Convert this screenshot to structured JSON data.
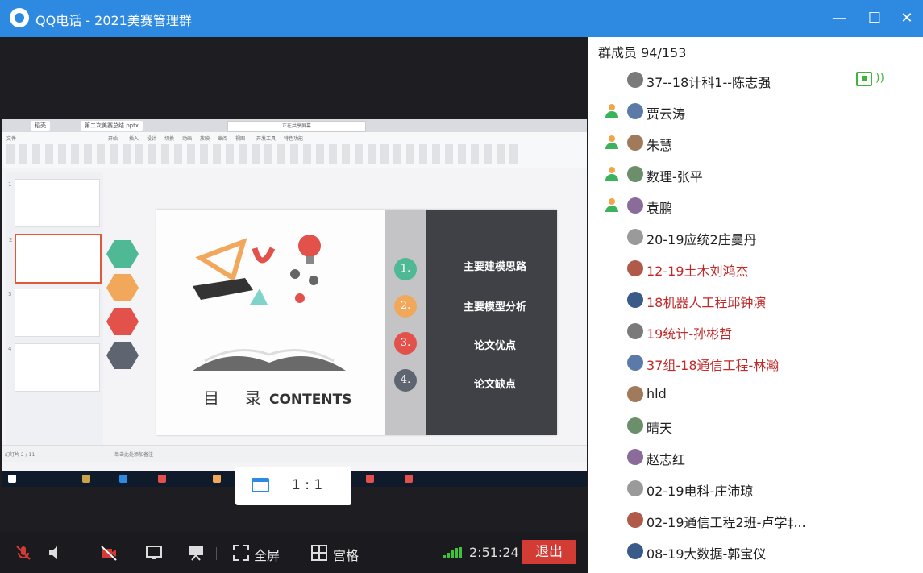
{
  "window": {
    "title": "QQ电话 - 2021美赛管理群",
    "min_label": "—",
    "max_label": "☐",
    "close_label": "✕"
  },
  "shared_screen": {
    "wps_tabs": [
      "稻壳",
      "第二次美赛总结.pptx"
    ],
    "record_bar": "正在共享屏幕",
    "menu": [
      "文件",
      "开始",
      "插入",
      "设计",
      "切换",
      "动画",
      "放映",
      "审阅",
      "视图",
      "开发工具",
      "特色功能"
    ],
    "slide": {
      "mulu_1": "目",
      "mulu_2": "录",
      "contents": "CONTENTS",
      "numbers": [
        "1.",
        "2.",
        "3.",
        "4."
      ],
      "items": [
        "主要建模思路",
        "主要模型分析",
        "论文优点",
        "论文缺点"
      ]
    },
    "thumb_numbers": [
      "1",
      "2",
      "3",
      "4"
    ],
    "status_left": "幻灯片 2 / 11",
    "status_note": "单击此处添加备注"
  },
  "ratio_button": {
    "label": "1 : 1"
  },
  "controls": {
    "fullscreen_label": "全屏",
    "grid_label": "宫格",
    "timer": "2:51:24",
    "exit_label": "退出"
  },
  "members": {
    "header": "群成员 94/153",
    "list": [
      {
        "name": "37--18计科1--陈志强",
        "red": false,
        "host": false,
        "sharing": true
      },
      {
        "name": "贾云涛",
        "red": false,
        "host": true
      },
      {
        "name": "朱慧",
        "red": false,
        "host": true
      },
      {
        "name": "数理-张平",
        "red": false,
        "host": true
      },
      {
        "name": "袁鹏",
        "red": false,
        "host": true
      },
      {
        "name": "20-19应统2庄曼丹",
        "red": false,
        "host": false
      },
      {
        "name": "12-19土木刘鸿杰",
        "red": true,
        "host": false
      },
      {
        "name": "18机器人工程邱钟演",
        "red": true,
        "host": false
      },
      {
        "name": "19统计-孙彬哲",
        "red": true,
        "host": false
      },
      {
        "name": "37组-18通信工程-林瀚",
        "red": true,
        "host": false
      },
      {
        "name": "hld",
        "red": false,
        "host": false
      },
      {
        "name": "晴天",
        "red": false,
        "host": false
      },
      {
        "name": "赵志红",
        "red": false,
        "host": false
      },
      {
        "name": "02-19电科-庄沛琼",
        "red": false,
        "host": false
      },
      {
        "name": "02-19通信工程2班-卢学‡...",
        "red": false,
        "host": false
      },
      {
        "name": "08-19大数据-郭宝仪",
        "red": false,
        "host": false
      }
    ]
  },
  "colors": {
    "titlebar": "#2e8ae0",
    "exit": "#d33b35",
    "signal": "#3fc33b",
    "hex": [
      "#4fb895",
      "#f2a85a",
      "#e2514a",
      "#5e6470"
    ],
    "circles": [
      "#4fb895",
      "#f2a85a",
      "#e2514a",
      "#5e6470"
    ]
  }
}
